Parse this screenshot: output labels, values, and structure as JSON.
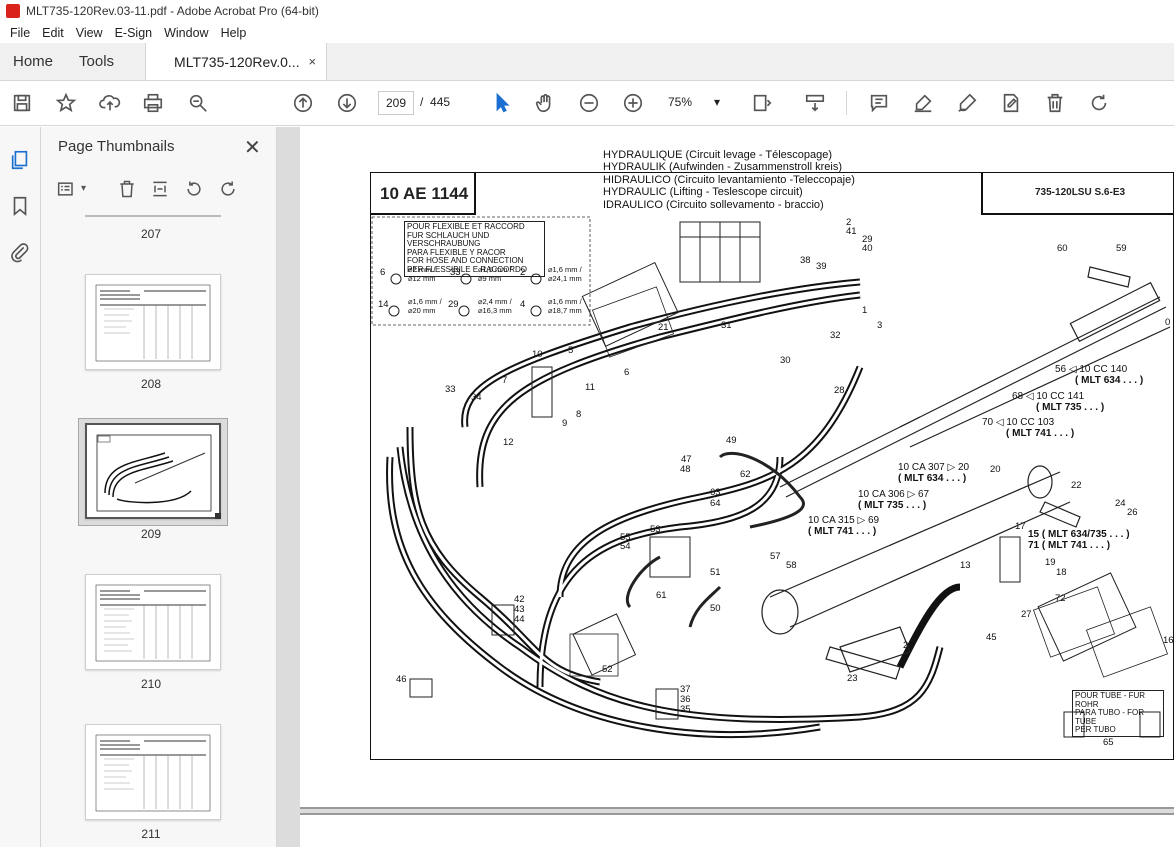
{
  "window": {
    "title": "MLT735-120Rev.03-11.pdf - Adobe Acrobat Pro (64-bit)"
  },
  "menu": [
    "File",
    "Edit",
    "View",
    "E-Sign",
    "Window",
    "Help"
  ],
  "tabs": {
    "home": "Home",
    "tools": "Tools",
    "document": "MLT735-120Rev.0...",
    "close": "×"
  },
  "toolbar": {
    "current_page": "209",
    "page_separator": "/",
    "total_pages": "445",
    "zoom": "75%",
    "icons": [
      "save-icon",
      "star-icon",
      "upload-icon",
      "print-icon",
      "search-icon",
      "page-up-icon",
      "page-down-icon",
      "select-cursor-icon",
      "hand-icon",
      "zoom-out-icon",
      "zoom-in-icon",
      "fit-page-icon",
      "scroll-mode-icon",
      "comment-icon",
      "highlight-icon",
      "sign-icon",
      "edit-page-icon",
      "delete-icon",
      "rotate-icon"
    ]
  },
  "panel": {
    "title": "Page Thumbnails",
    "close": "✕",
    "thumbnails": [
      {
        "label": "207"
      },
      {
        "label": "208"
      },
      {
        "label": "209",
        "selected": true
      },
      {
        "label": "210"
      },
      {
        "label": "211"
      }
    ]
  },
  "document": {
    "code": "10 AE 1144",
    "titles": [
      "HYDRAULIQUE (Circuit levage - Télescopage)",
      "HYDRAULIK (Aufwinden - Zusammenstroll kreis)",
      "HIDRAULICO (Circuito levantamiento -Teleccopaje)",
      "HYDRAULIC (Lifting - Teslescope circuit)",
      "IDRAULICO (Circuito sollevamento - braccio)"
    ],
    "model": "735-120LSU S.6-E3",
    "hose_box": [
      "POUR FLEXIBLE ET RACCORD",
      "FUR SCHLAUCH UND VERSCHRAUBUNG",
      "PARA FLEXIBLE Y RACOR",
      "FOR HOSE AND CONNECTION",
      "PER FLESSIBILE E RACCORDO"
    ],
    "tube_box": [
      "POUR TUBE - FUR ROHR",
      "PARA TUBO - FOR TUBE",
      "PER TUBO"
    ],
    "refs": [
      {
        "code": "56 ◁ 10 CC 140",
        "model": "( MLT 634 . . . )"
      },
      {
        "code": "68 ◁ 10 CC 141",
        "model": "( MLT 735 . . . )"
      },
      {
        "code": "70 ◁ 10 CC 103",
        "model": "( MLT 741 . . . )"
      },
      {
        "code": "10 CA 307 ▷ 20",
        "model": "( MLT 634 . . . )"
      },
      {
        "code": "10 CA 306 ▷ 67",
        "model": "( MLT 735 . . . )"
      },
      {
        "code": "10 CA 315 ▷ 69",
        "model": "( MLT 741 . . . )"
      },
      {
        "code": "15 ( MLT 634/735 . . . )",
        "model": "71 ( MLT 741 . . . )"
      }
    ],
    "fittings": [
      {
        "n": "6",
        "size": "⌀2 mm / ⌀12 mm"
      },
      {
        "n": "33",
        "size": "⌀1,5 mm / ⌀9 mm"
      },
      {
        "n": "2",
        "size": "⌀1,6 mm / ⌀24,1 mm"
      },
      {
        "n": "14",
        "size": "⌀1,6 mm / ⌀20 mm"
      },
      {
        "n": "29",
        "size": "⌀2,4 mm / ⌀16,3 mm"
      },
      {
        "n": "4",
        "size": "⌀1,6 mm / ⌀18,7 mm"
      }
    ],
    "part_numbers": [
      "2",
      "41",
      "29",
      "40",
      "38",
      "39",
      "60",
      "59",
      "21",
      "31",
      "1",
      "32",
      "3",
      "10",
      "5",
      "6",
      "7",
      "33",
      "34",
      "8",
      "9",
      "11",
      "12",
      "30",
      "28",
      "49",
      "47",
      "48",
      "63",
      "64",
      "62",
      "22",
      "24",
      "26",
      "17",
      "13",
      "18",
      "19",
      "72",
      "53",
      "55",
      "54",
      "57",
      "58",
      "42",
      "43",
      "44",
      "46",
      "37",
      "36",
      "35",
      "52",
      "50",
      "51",
      "61",
      "25",
      "23",
      "27",
      "45",
      "65",
      "20",
      "0",
      "16"
    ]
  }
}
